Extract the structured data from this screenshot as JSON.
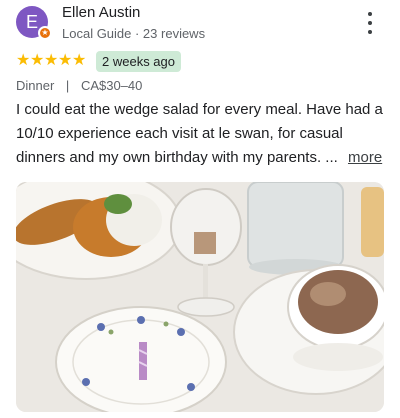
{
  "reviewer": {
    "avatar_initial": "E",
    "name": "Ellen Austin",
    "subline": "Local Guide · 23 reviews",
    "badge_icon": "local-guide-star-icon",
    "avatar_color": "#7e57c2"
  },
  "rating": {
    "stars": 5,
    "star_color": "#fbbc04",
    "time_ago": "2 weeks ago"
  },
  "meta": {
    "meal": "Dinner",
    "separator": "|",
    "price": "CA$30–40"
  },
  "review": {
    "text": "I could eat the wedge salad for every meal. Have had a 10/10 experience each visit at le swan, for casual dinners and my own birthday with my parents. ...",
    "more_label": "more"
  },
  "photo": {
    "icon": "review-photo"
  }
}
